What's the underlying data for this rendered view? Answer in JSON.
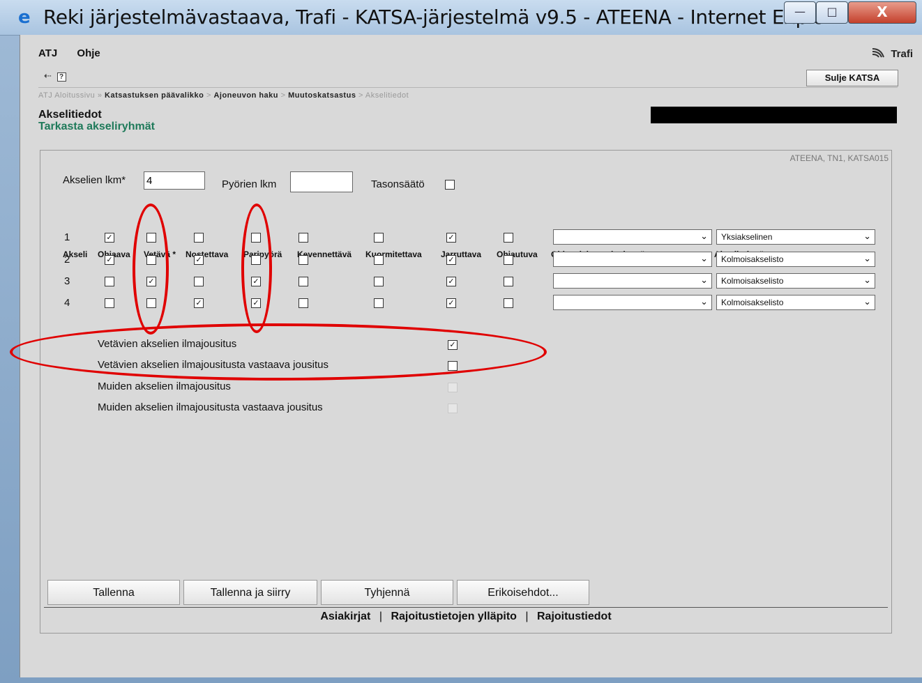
{
  "window": {
    "title": "Reki järjestelmävastaava, Trafi - KATSA-järjestelmä v9.5 - ATEENA - Internet Explo...",
    "minimize": "—",
    "maximize": "□",
    "close": "X"
  },
  "menu": {
    "items": [
      "ATJ",
      "Ohje"
    ],
    "logo": "Trafi"
  },
  "toolbar": {
    "back_icon": "back-arrow-icon",
    "help_icon": "?",
    "close_katsa": "Sulje KATSA"
  },
  "breadcrumb": {
    "items": [
      "ATJ Aloitussivu",
      "Katsastuksen päävalikko",
      "Ajoneuvon haku",
      "Muutoskatsastus",
      "Akselitiedot"
    ],
    "separators": [
      "»",
      ">",
      ">",
      ">"
    ]
  },
  "page": {
    "title": "Akselitiedot",
    "subtitle": "Tarkasta akseliryhmät",
    "screen_id": "ATEENA, TN1, KATSA015"
  },
  "form": {
    "axle_count_label": "Akselien lkm*",
    "axle_count_value": "4",
    "wheel_count_label": "Pyörien lkm",
    "wheel_count_value": "",
    "leveling_label": "Tasonsäätö",
    "leveling_checked": false
  },
  "table": {
    "headers": [
      "Akseli",
      "Ohjaava",
      "Vetävä *",
      "Nostettava",
      "Paripyörä",
      "Kevennettävä",
      "Kuormitettava",
      "Jarruttava",
      "Ohjautuva",
      "Ohjauslaitteen kytkentä",
      "Akseliryhmä"
    ],
    "rows": [
      {
        "axle": "1",
        "checks": [
          true,
          false,
          false,
          false,
          false,
          false,
          true,
          false
        ],
        "coupling": "",
        "group": "Yksiakselinen"
      },
      {
        "axle": "2",
        "checks": [
          true,
          false,
          true,
          false,
          false,
          false,
          true,
          false
        ],
        "coupling": "",
        "group": "Kolmoisakselisto"
      },
      {
        "axle": "3",
        "checks": [
          false,
          true,
          false,
          true,
          false,
          false,
          true,
          false
        ],
        "coupling": "",
        "group": "Kolmoisakselisto"
      },
      {
        "axle": "4",
        "checks": [
          false,
          false,
          true,
          true,
          false,
          false,
          true,
          false
        ],
        "coupling": "",
        "group": "Kolmoisakselisto"
      }
    ]
  },
  "suspension": [
    {
      "label": "Vetävien akselien ilmajousitus",
      "checked": true,
      "disabled": false
    },
    {
      "label": "Vetävien akselien ilmajousitusta vastaava jousitus",
      "checked": false,
      "disabled": false
    },
    {
      "label": "Muiden akselien ilmajousitus",
      "checked": false,
      "disabled": true
    },
    {
      "label": "Muiden akselien ilmajousitusta vastaava jousitus",
      "checked": false,
      "disabled": true
    }
  ],
  "buttons": {
    "save": "Tallenna",
    "save_and_go": "Tallenna ja siirry",
    "clear": "Tyhjennä",
    "special": "Erikoisehdot..."
  },
  "footer_links": [
    "Asiakirjat",
    "Rajoitustietojen ylläpito",
    "Rajoitustiedot"
  ],
  "footer_separator": "|",
  "colors": {
    "annotation": "#e00000",
    "subtitle": "#1f7a5a",
    "panel_bg": "#d9d9d9"
  }
}
